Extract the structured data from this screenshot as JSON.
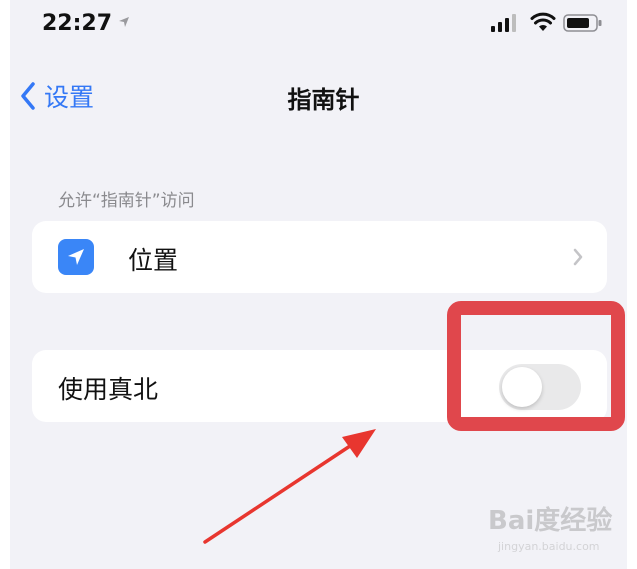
{
  "status_bar": {
    "time": "22:27",
    "icons": [
      "location-arrow-icon",
      "signal-icon",
      "wifi-icon",
      "battery-icon"
    ]
  },
  "nav": {
    "back_label": "设置",
    "title": "指南针"
  },
  "access_section": {
    "header": "允许“指南针”访问",
    "location_row": {
      "label": "位置",
      "icon": "location-arrow-icon"
    }
  },
  "true_north_row": {
    "label": "使用真北",
    "toggle_on": false
  },
  "annotation": {
    "color": "#e0474c"
  },
  "watermark": {
    "text": "Bai度经验",
    "sub": "jingyan.baidu.com"
  },
  "colors": {
    "accent": "#3478f6",
    "background": "#f2f2f7",
    "toggle_off": "#e9e9ea"
  }
}
